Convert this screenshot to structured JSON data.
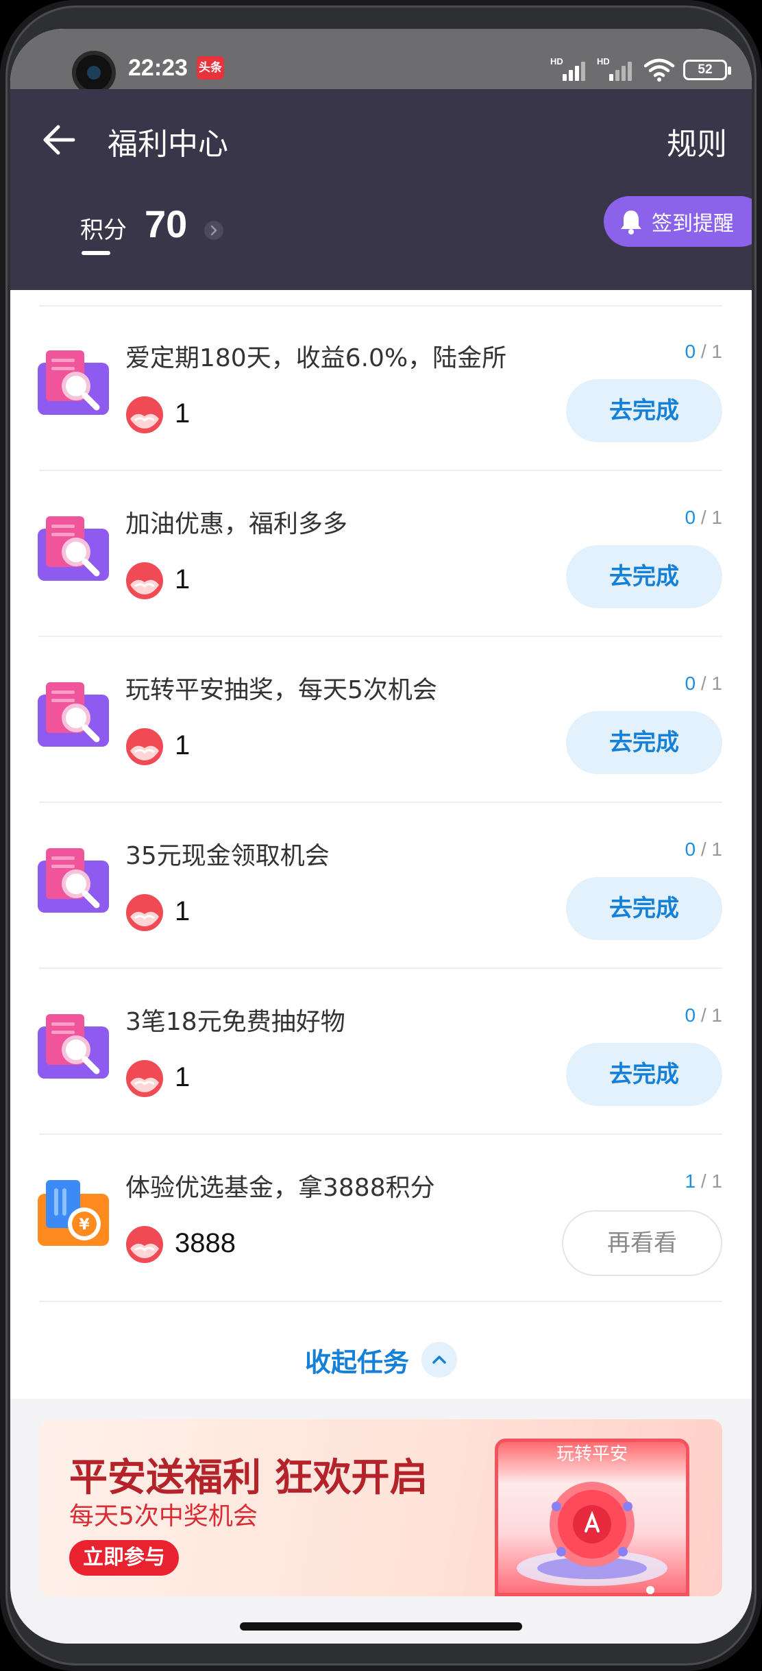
{
  "status_bar": {
    "time": "22:23",
    "app_badge": "头条",
    "signal_1": "HD",
    "signal_2": "HD",
    "battery": "52"
  },
  "header": {
    "title": "福利中心",
    "rules_label": "规则",
    "points_label": "积分",
    "points_value": "70",
    "remind_label": "签到提醒"
  },
  "tasks": [
    {
      "title": "爱定期180天，收益6.0%，陆金所",
      "reward": "1",
      "progress_done": "0",
      "progress_total": "1",
      "action": "去完成",
      "icon": "document-search-icon"
    },
    {
      "title": "加油优惠，福利多多",
      "reward": "1",
      "progress_done": "0",
      "progress_total": "1",
      "action": "去完成",
      "icon": "document-search-icon"
    },
    {
      "title": "玩转平安抽奖，每天5次机会",
      "reward": "1",
      "progress_done": "0",
      "progress_total": "1",
      "action": "去完成",
      "icon": "document-search-icon"
    },
    {
      "title": "35元现金领取机会",
      "reward": "1",
      "progress_done": "0",
      "progress_total": "1",
      "action": "去完成",
      "icon": "document-search-icon"
    },
    {
      "title": "3笔18元免费抽好物",
      "reward": "1",
      "progress_done": "0",
      "progress_total": "1",
      "action": "去完成",
      "icon": "document-search-icon"
    },
    {
      "title": "体验优选基金，拿3888积分",
      "reward": "3888",
      "progress_done": "1",
      "progress_total": "1",
      "action": "再看看",
      "icon": "fund-card-icon"
    }
  ],
  "progress_separator": "/",
  "collapse_label": "收起任务",
  "banner": {
    "title": "平安送福利 狂欢开启",
    "subtitle": "每天5次中奖机会",
    "cta": "立即参与",
    "card_label": "玩转平安"
  },
  "colors": {
    "header_bg": "#393649",
    "accent_blue": "#1580d8",
    "remind_purple": "#8a63ea",
    "banner_red": "#e8222e"
  }
}
